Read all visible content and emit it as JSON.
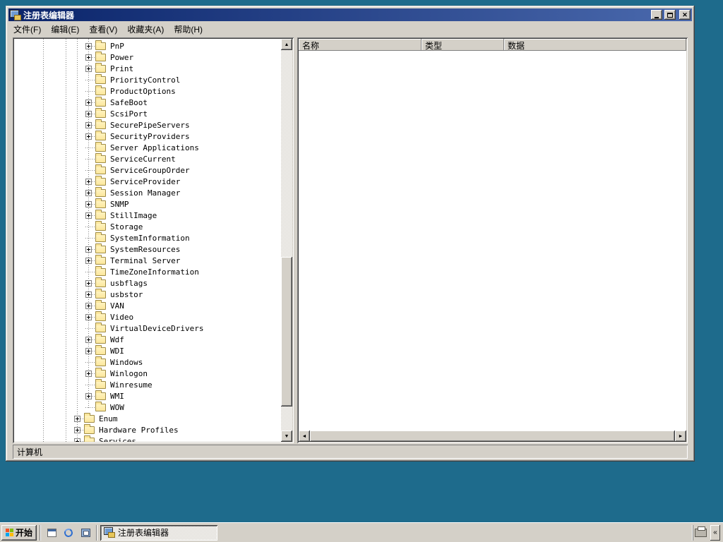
{
  "colors": {
    "desktop": "#1e6b8c",
    "chrome": "#d4d0c8",
    "titlebar_left": "#0a246a",
    "titlebar_right": "#4a69ad",
    "folder_face": "#fce79c",
    "folder_edge": "#a08c46"
  },
  "icons": {
    "close": "✕",
    "scroll_up": "▲",
    "scroll_down": "▼",
    "scroll_left": "◄",
    "scroll_right": "►",
    "tray_chevron": "«"
  },
  "window": {
    "title": "注册表编辑器"
  },
  "menu": {
    "items": [
      {
        "name": "file",
        "label": "文件(F)"
      },
      {
        "name": "edit",
        "label": "编辑(E)"
      },
      {
        "name": "view",
        "label": "查看(V)"
      },
      {
        "name": "favorites",
        "label": "收藏夹(A)"
      },
      {
        "name": "help",
        "label": "帮助(H)"
      }
    ]
  },
  "tree": {
    "items": [
      {
        "label": "PnP",
        "expandable": true,
        "level": 2
      },
      {
        "label": "Power",
        "expandable": true,
        "level": 2
      },
      {
        "label": "Print",
        "expandable": true,
        "level": 2
      },
      {
        "label": "PriorityControl",
        "expandable": false,
        "level": 2
      },
      {
        "label": "ProductOptions",
        "expandable": false,
        "level": 2
      },
      {
        "label": "SafeBoot",
        "expandable": true,
        "level": 2
      },
      {
        "label": "ScsiPort",
        "expandable": true,
        "level": 2
      },
      {
        "label": "SecurePipeServers",
        "expandable": true,
        "level": 2
      },
      {
        "label": "SecurityProviders",
        "expandable": true,
        "level": 2
      },
      {
        "label": "Server Applications",
        "expandable": false,
        "level": 2
      },
      {
        "label": "ServiceCurrent",
        "expandable": false,
        "level": 2
      },
      {
        "label": "ServiceGroupOrder",
        "expandable": false,
        "level": 2
      },
      {
        "label": "ServiceProvider",
        "expandable": true,
        "level": 2
      },
      {
        "label": "Session Manager",
        "expandable": true,
        "level": 2
      },
      {
        "label": "SNMP",
        "expandable": true,
        "level": 2
      },
      {
        "label": "StillImage",
        "expandable": true,
        "level": 2
      },
      {
        "label": "Storage",
        "expandable": false,
        "level": 2
      },
      {
        "label": "SystemInformation",
        "expandable": false,
        "level": 2
      },
      {
        "label": "SystemResources",
        "expandable": true,
        "level": 2
      },
      {
        "label": "Terminal Server",
        "expandable": true,
        "level": 2
      },
      {
        "label": "TimeZoneInformation",
        "expandable": false,
        "level": 2
      },
      {
        "label": "usbflags",
        "expandable": true,
        "level": 2
      },
      {
        "label": "usbstor",
        "expandable": true,
        "level": 2
      },
      {
        "label": "VAN",
        "expandable": true,
        "level": 2
      },
      {
        "label": "Video",
        "expandable": true,
        "level": 2
      },
      {
        "label": "VirtualDeviceDrivers",
        "expandable": false,
        "level": 2
      },
      {
        "label": "Wdf",
        "expandable": true,
        "level": 2
      },
      {
        "label": "WDI",
        "expandable": true,
        "level": 2
      },
      {
        "label": "Windows",
        "expandable": false,
        "level": 2
      },
      {
        "label": "Winlogon",
        "expandable": true,
        "level": 2
      },
      {
        "label": "Winresume",
        "expandable": false,
        "level": 2
      },
      {
        "label": "WMI",
        "expandable": true,
        "level": 2
      },
      {
        "label": "WOW",
        "expandable": false,
        "level": 2
      },
      {
        "label": "Enum",
        "expandable": true,
        "level": 1
      },
      {
        "label": "Hardware Profiles",
        "expandable": true,
        "level": 1
      },
      {
        "label": "Services",
        "expandable": true,
        "level": 1
      }
    ]
  },
  "list": {
    "columns": [
      {
        "name": "name",
        "label": "名称"
      },
      {
        "name": "type",
        "label": "类型"
      },
      {
        "name": "data",
        "label": "数据"
      }
    ]
  },
  "statusbar": {
    "text": "计算机"
  },
  "taskbar": {
    "start_label": "开始",
    "task_label": "注册表编辑器",
    "quick_launch": [
      {
        "name": "show-desktop-icon"
      },
      {
        "name": "internet-explorer-icon"
      },
      {
        "name": "explorer-icon"
      }
    ]
  }
}
